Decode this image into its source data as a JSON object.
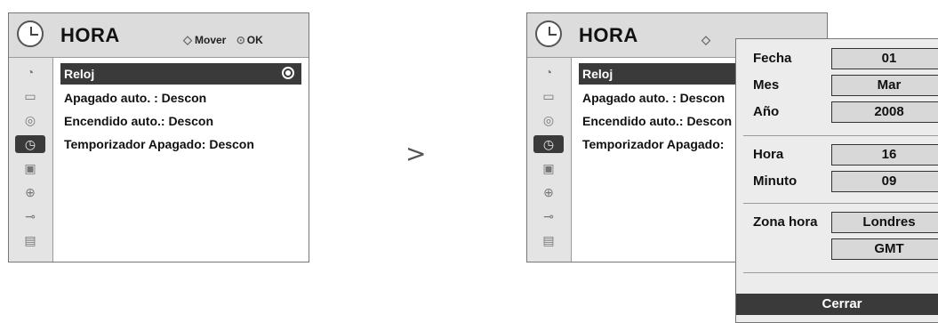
{
  "left_menu": {
    "title": "HORA",
    "hint_move": "Mover",
    "hint_ok": "OK",
    "items": [
      {
        "label": "Reloj"
      },
      {
        "label": "Apagado auto.  : Descon"
      },
      {
        "label": "Encendido auto.: Descon"
      },
      {
        "label": "Temporizador Apagado: Descon"
      }
    ]
  },
  "right_menu": {
    "title": "HORA",
    "items": [
      {
        "label": "Reloj"
      },
      {
        "label": "Apagado auto.  : Descon"
      },
      {
        "label": "Encendido auto.: Descon"
      },
      {
        "label": "Temporizador Apagado:"
      }
    ]
  },
  "sidebar_icons": [
    "satellite-dish-icon",
    "picture-icon",
    "speaker-icon",
    "clock-icon",
    "lock-panel-icon",
    "padlock-icon",
    "input-plug-icon",
    "clapperboard-icon"
  ],
  "arrow_glyph": ">",
  "clock_popup": {
    "fields": [
      {
        "label": "Fecha",
        "value": "01"
      },
      {
        "label": "Mes",
        "value": "Mar"
      },
      {
        "label": "Año",
        "value": "2008"
      },
      {
        "label": "Hora",
        "value": "16"
      },
      {
        "label": "Minuto",
        "value": "09"
      },
      {
        "label": "Zona hora",
        "value": "Londres"
      },
      {
        "label": "",
        "value": "GMT"
      }
    ],
    "close_label": "Cerrar"
  },
  "colors": {
    "selected_bg": "#3a3a3a",
    "header_bg": "#dcdcdc",
    "sidebar_bg": "#e4e4e4",
    "value_box_bg": "#d8d8d8"
  }
}
